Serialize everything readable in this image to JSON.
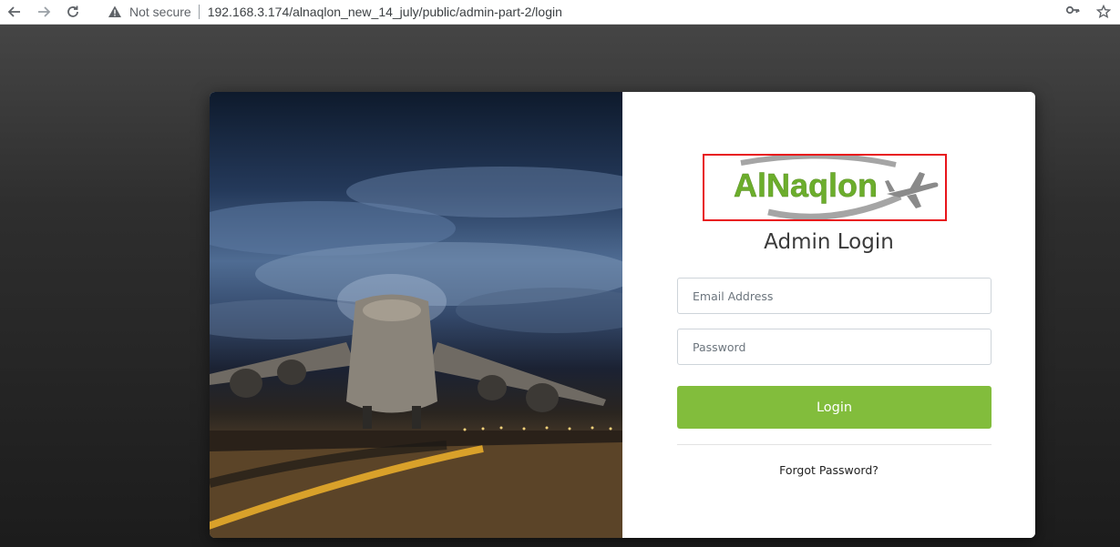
{
  "browser": {
    "security_label": "Not secure",
    "url": "192.168.3.174/alnaqlon_new_14_july/public/admin-part-2/login"
  },
  "logo": {
    "text": "AlNaqlon"
  },
  "login": {
    "title": "Admin Login",
    "email_placeholder": "Email Address",
    "password_placeholder": "Password",
    "button_label": "Login",
    "forgot_link": "Forgot Password?"
  },
  "colors": {
    "login_button": "#82bd3c",
    "logo_highlight_border": "#e8151b"
  }
}
